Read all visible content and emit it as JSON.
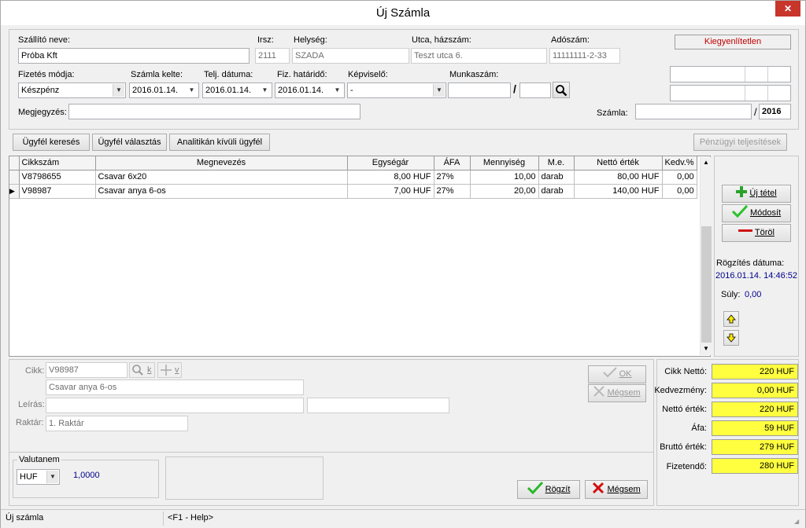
{
  "window": {
    "title": "Új Számla",
    "close": "✕"
  },
  "status_badge": "Kiegyenlítetlen",
  "supplier": {
    "label": "Szállító neve:",
    "value": "Próba Kft",
    "zip_label": "Irsz:",
    "zip": "2111",
    "city_label": "Helység:",
    "city": "SZADA",
    "street_label": "Utca, házszám:",
    "street": "Teszt utca 6.",
    "tax_label": "Adószám:",
    "tax": "11111111-2-33"
  },
  "row2": {
    "payment_label": "Fizetés módja:",
    "payment": "Készpénz",
    "issue_label": "Számla kelte:",
    "issue": "2016.01.14.",
    "perf_label": "Telj. dátuma:",
    "perf": "2016.01.14.",
    "due_label": "Fiz. határidő:",
    "due": "2016.01.14.",
    "rep_label": "Képviselő:",
    "rep": "-",
    "job_label": "Munkaszám:",
    "job_sep": "/"
  },
  "note": {
    "label": "Megjegyzés:",
    "value": ""
  },
  "invoice": {
    "label": "Számla:",
    "sep": "/",
    "year": "2016"
  },
  "toolbar": {
    "search": "Ügyfél keresés",
    "select": "Ügyfél választás",
    "outside": "Analitikán kívüli ügyfél",
    "financial": "Pénzügyi teljesítések"
  },
  "table": {
    "headers": [
      "Cikkszám",
      "Megnevezés",
      "Egységár",
      "ÁFA",
      "Mennyiség",
      "M.e.",
      "Nettó érték",
      "Kedv.%"
    ],
    "rows": [
      [
        "V8798655",
        "Csavar 6x20",
        "8,00 HUF",
        "27%",
        "10,00",
        "darab",
        "80,00 HUF",
        "0,00"
      ],
      [
        "V98987",
        "Csavar anya 6-os",
        "7,00 HUF",
        "27%",
        "20,00",
        "darab",
        "140,00 HUF",
        "0,00"
      ]
    ]
  },
  "side": {
    "new_item": "Új tétel",
    "modify": "Módosít",
    "delete": "Töröl",
    "rec_date_label": "Rögzítés dátuma:",
    "rec_date": "2016.01.14. 14:46:52",
    "weight_label": "Súly:",
    "weight": "0,00"
  },
  "detail": {
    "item_label": "Cikk:",
    "item": "V98987",
    "k": "k",
    "v": "v",
    "item_name": "Csavar anya 6-os",
    "desc_label": "Leírás:",
    "store_label": "Raktár:",
    "store": "1. Raktár",
    "ok": "OK",
    "cancel": "Mégsem"
  },
  "currency": {
    "label": "Valutanem",
    "value": "HUF",
    "rate": "1,0000"
  },
  "summary": {
    "items": [
      {
        "label": "Cikk Nettó:",
        "value": "220 HUF"
      },
      {
        "label": "Kedvezmény:",
        "value": "0,00 HUF"
      },
      {
        "label": "Nettó érték:",
        "value": "220 HUF"
      },
      {
        "label": "Áfa:",
        "value": "59 HUF"
      },
      {
        "label": "Bruttó érték:",
        "value": "279 HUF"
      },
      {
        "label": "Fizetendő:",
        "value": "280 HUF"
      }
    ]
  },
  "actions": {
    "save": "Rögzít",
    "cancel": "Mégsem"
  },
  "statusbar": {
    "left": "Új számla",
    "help": "<F1 - Help>"
  },
  "colors": {
    "highlight": "#ffff3f",
    "badge_text": "#c00000",
    "link_blue": "#00008b"
  }
}
